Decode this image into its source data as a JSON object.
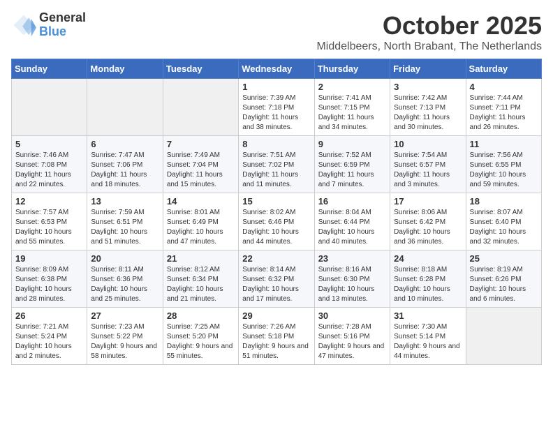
{
  "header": {
    "logo_general": "General",
    "logo_blue": "Blue",
    "month_title": "October 2025",
    "subtitle": "Middelbeers, North Brabant, The Netherlands"
  },
  "calendar": {
    "days_of_week": [
      "Sunday",
      "Monday",
      "Tuesday",
      "Wednesday",
      "Thursday",
      "Friday",
      "Saturday"
    ],
    "weeks": [
      [
        {
          "day": "",
          "info": ""
        },
        {
          "day": "",
          "info": ""
        },
        {
          "day": "",
          "info": ""
        },
        {
          "day": "1",
          "info": "Sunrise: 7:39 AM\nSunset: 7:18 PM\nDaylight: 11 hours\nand 38 minutes."
        },
        {
          "day": "2",
          "info": "Sunrise: 7:41 AM\nSunset: 7:15 PM\nDaylight: 11 hours\nand 34 minutes."
        },
        {
          "day": "3",
          "info": "Sunrise: 7:42 AM\nSunset: 7:13 PM\nDaylight: 11 hours\nand 30 minutes."
        },
        {
          "day": "4",
          "info": "Sunrise: 7:44 AM\nSunset: 7:11 PM\nDaylight: 11 hours\nand 26 minutes."
        }
      ],
      [
        {
          "day": "5",
          "info": "Sunrise: 7:46 AM\nSunset: 7:08 PM\nDaylight: 11 hours\nand 22 minutes."
        },
        {
          "day": "6",
          "info": "Sunrise: 7:47 AM\nSunset: 7:06 PM\nDaylight: 11 hours\nand 18 minutes."
        },
        {
          "day": "7",
          "info": "Sunrise: 7:49 AM\nSunset: 7:04 PM\nDaylight: 11 hours\nand 15 minutes."
        },
        {
          "day": "8",
          "info": "Sunrise: 7:51 AM\nSunset: 7:02 PM\nDaylight: 11 hours\nand 11 minutes."
        },
        {
          "day": "9",
          "info": "Sunrise: 7:52 AM\nSunset: 6:59 PM\nDaylight: 11 hours\nand 7 minutes."
        },
        {
          "day": "10",
          "info": "Sunrise: 7:54 AM\nSunset: 6:57 PM\nDaylight: 11 hours\nand 3 minutes."
        },
        {
          "day": "11",
          "info": "Sunrise: 7:56 AM\nSunset: 6:55 PM\nDaylight: 10 hours\nand 59 minutes."
        }
      ],
      [
        {
          "day": "12",
          "info": "Sunrise: 7:57 AM\nSunset: 6:53 PM\nDaylight: 10 hours\nand 55 minutes."
        },
        {
          "day": "13",
          "info": "Sunrise: 7:59 AM\nSunset: 6:51 PM\nDaylight: 10 hours\nand 51 minutes."
        },
        {
          "day": "14",
          "info": "Sunrise: 8:01 AM\nSunset: 6:49 PM\nDaylight: 10 hours\nand 47 minutes."
        },
        {
          "day": "15",
          "info": "Sunrise: 8:02 AM\nSunset: 6:46 PM\nDaylight: 10 hours\nand 44 minutes."
        },
        {
          "day": "16",
          "info": "Sunrise: 8:04 AM\nSunset: 6:44 PM\nDaylight: 10 hours\nand 40 minutes."
        },
        {
          "day": "17",
          "info": "Sunrise: 8:06 AM\nSunset: 6:42 PM\nDaylight: 10 hours\nand 36 minutes."
        },
        {
          "day": "18",
          "info": "Sunrise: 8:07 AM\nSunset: 6:40 PM\nDaylight: 10 hours\nand 32 minutes."
        }
      ],
      [
        {
          "day": "19",
          "info": "Sunrise: 8:09 AM\nSunset: 6:38 PM\nDaylight: 10 hours\nand 28 minutes."
        },
        {
          "day": "20",
          "info": "Sunrise: 8:11 AM\nSunset: 6:36 PM\nDaylight: 10 hours\nand 25 minutes."
        },
        {
          "day": "21",
          "info": "Sunrise: 8:12 AM\nSunset: 6:34 PM\nDaylight: 10 hours\nand 21 minutes."
        },
        {
          "day": "22",
          "info": "Sunrise: 8:14 AM\nSunset: 6:32 PM\nDaylight: 10 hours\nand 17 minutes."
        },
        {
          "day": "23",
          "info": "Sunrise: 8:16 AM\nSunset: 6:30 PM\nDaylight: 10 hours\nand 13 minutes."
        },
        {
          "day": "24",
          "info": "Sunrise: 8:18 AM\nSunset: 6:28 PM\nDaylight: 10 hours\nand 10 minutes."
        },
        {
          "day": "25",
          "info": "Sunrise: 8:19 AM\nSunset: 6:26 PM\nDaylight: 10 hours\nand 6 minutes."
        }
      ],
      [
        {
          "day": "26",
          "info": "Sunrise: 7:21 AM\nSunset: 5:24 PM\nDaylight: 10 hours\nand 2 minutes."
        },
        {
          "day": "27",
          "info": "Sunrise: 7:23 AM\nSunset: 5:22 PM\nDaylight: 9 hours\nand 58 minutes."
        },
        {
          "day": "28",
          "info": "Sunrise: 7:25 AM\nSunset: 5:20 PM\nDaylight: 9 hours\nand 55 minutes."
        },
        {
          "day": "29",
          "info": "Sunrise: 7:26 AM\nSunset: 5:18 PM\nDaylight: 9 hours\nand 51 minutes."
        },
        {
          "day": "30",
          "info": "Sunrise: 7:28 AM\nSunset: 5:16 PM\nDaylight: 9 hours\nand 47 minutes."
        },
        {
          "day": "31",
          "info": "Sunrise: 7:30 AM\nSunset: 5:14 PM\nDaylight: 9 hours\nand 44 minutes."
        },
        {
          "day": "",
          "info": ""
        }
      ]
    ]
  }
}
